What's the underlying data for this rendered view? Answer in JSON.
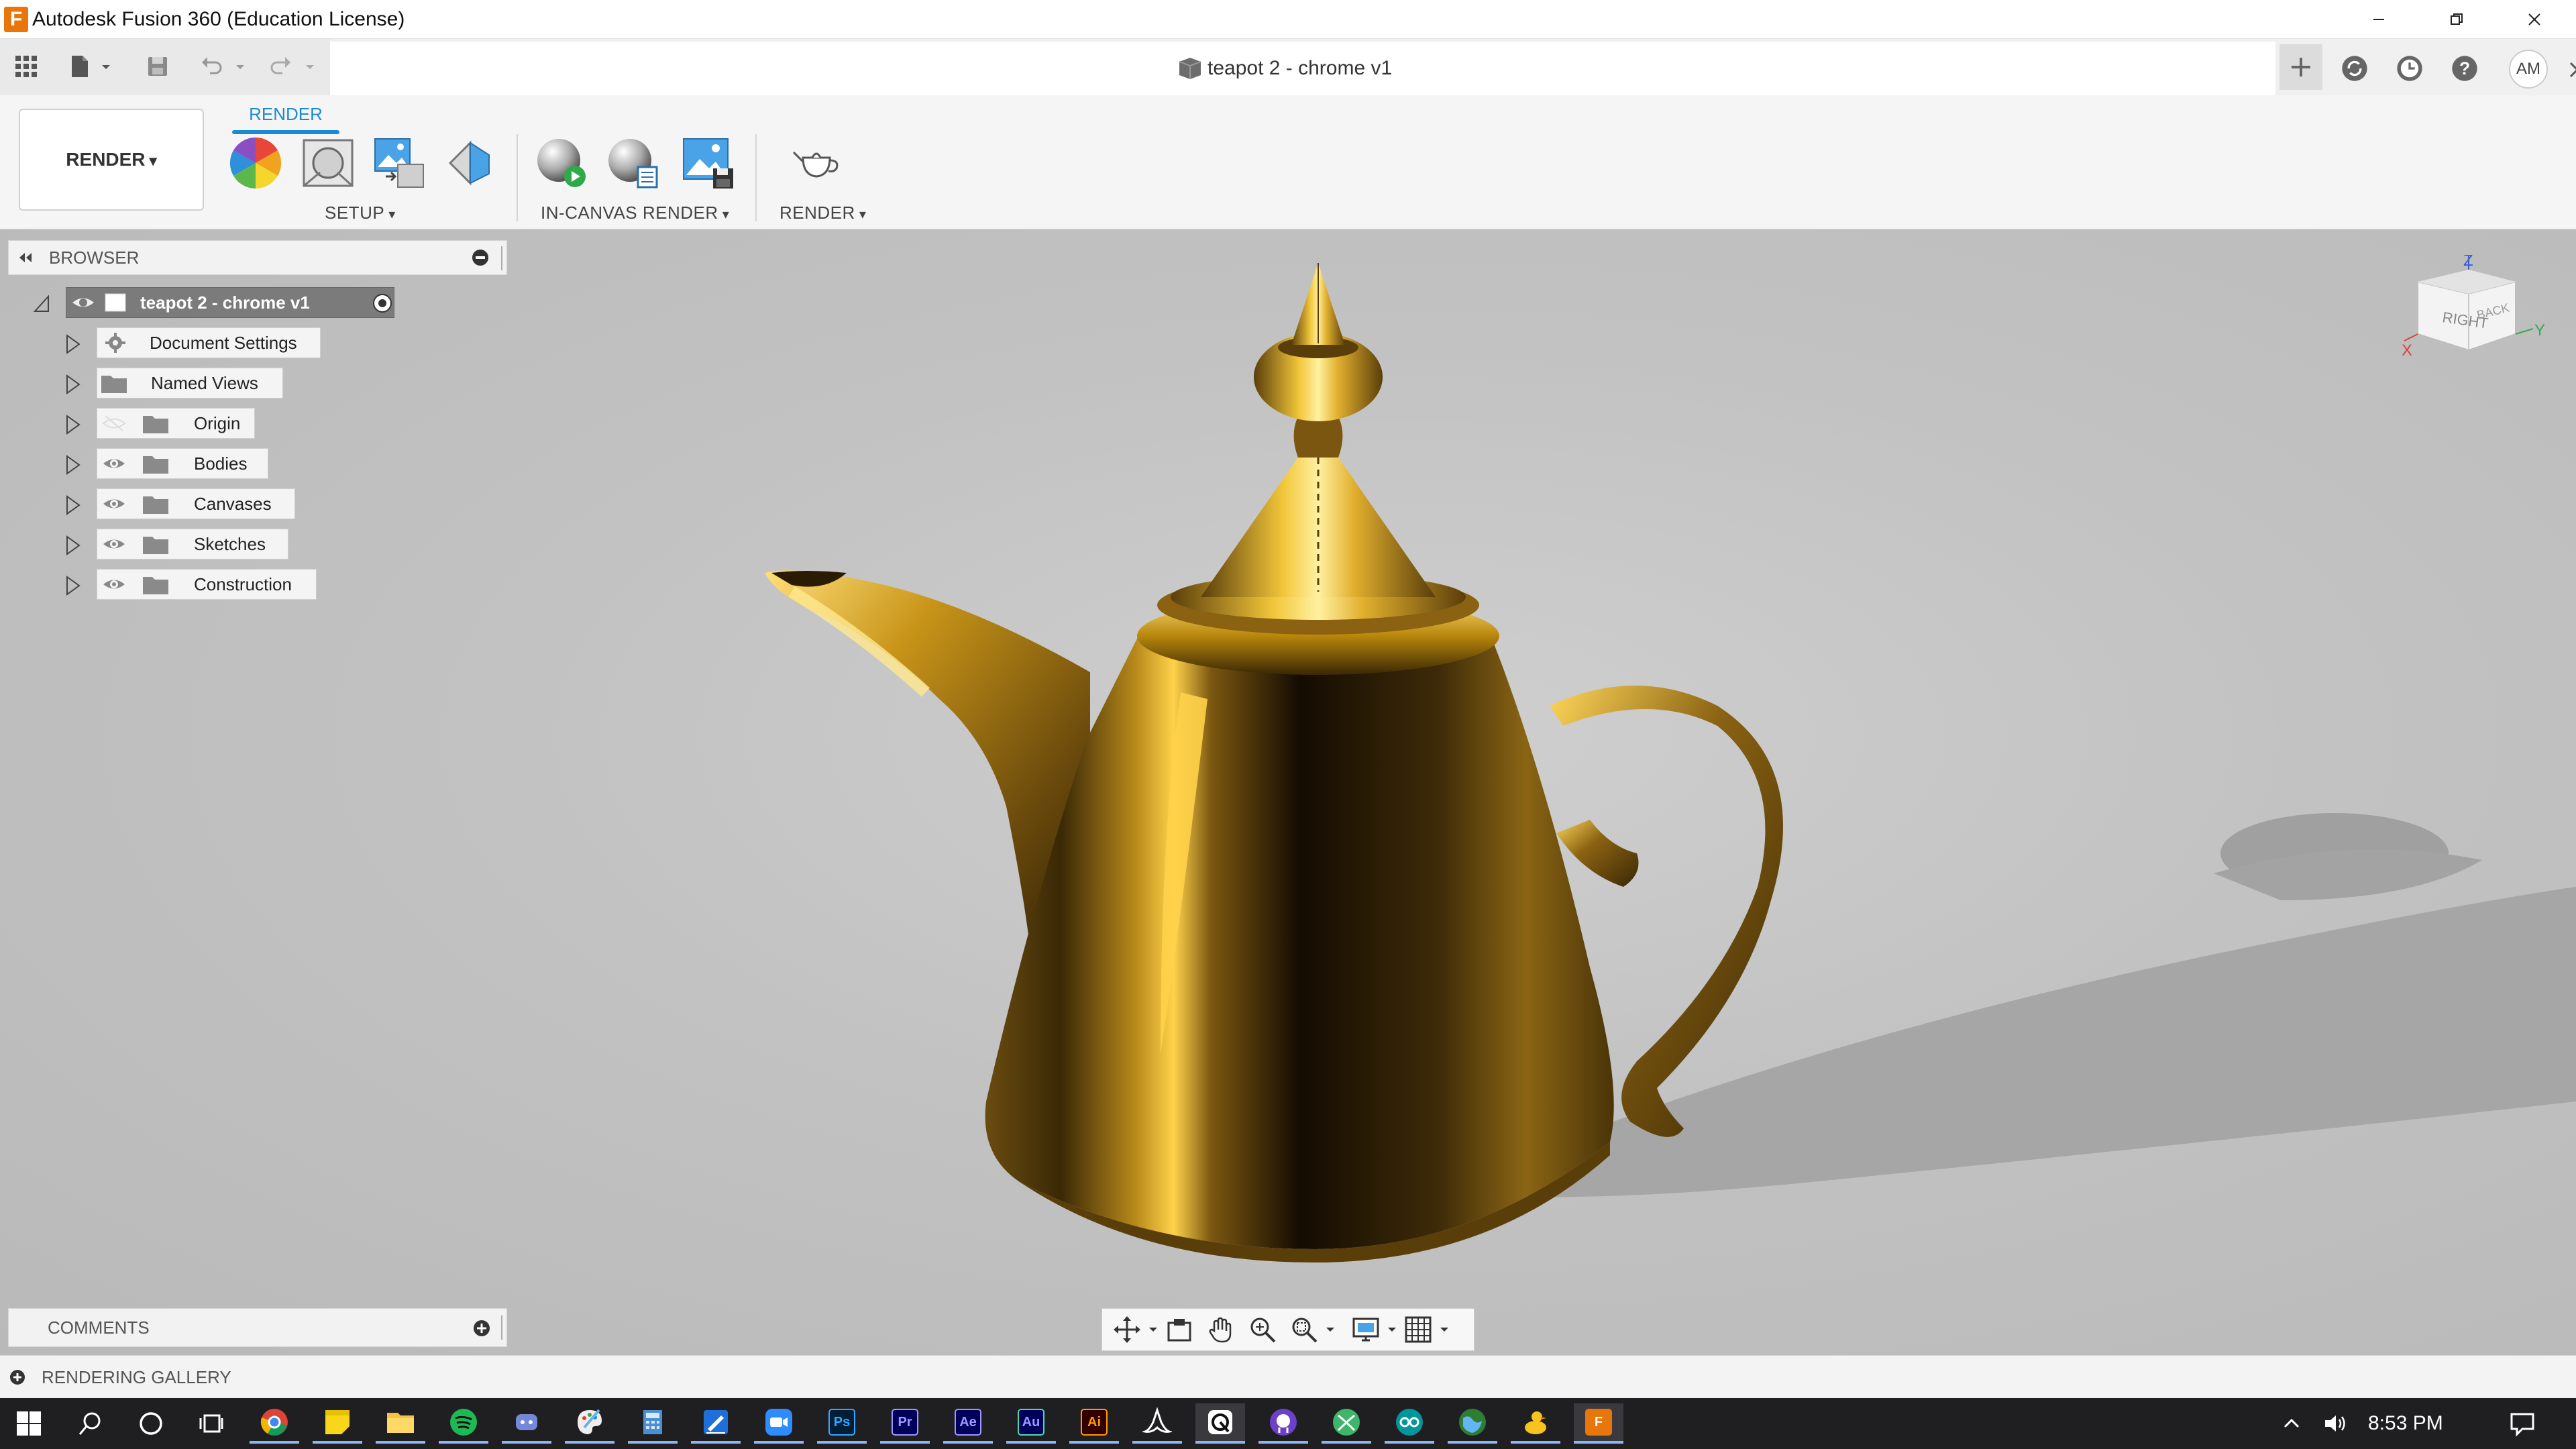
{
  "window": {
    "logo_letter": "F",
    "title": "Autodesk Fusion 360 (Education License)"
  },
  "document_tab": {
    "title": "teapot 2 - chrome v1"
  },
  "user": {
    "initials": "AM"
  },
  "ribbon": {
    "workspace": "RENDER",
    "active_tab": "RENDER",
    "groups": [
      {
        "label": "SETUP"
      },
      {
        "label": "IN-CANVAS RENDER"
      },
      {
        "label": "RENDER"
      }
    ]
  },
  "browser": {
    "title": "BROWSER",
    "root": "teapot 2 - chrome v1",
    "items": [
      {
        "label": "Document Settings"
      },
      {
        "label": "Named Views"
      },
      {
        "label": "Origin"
      },
      {
        "label": "Bodies"
      },
      {
        "label": "Canvases"
      },
      {
        "label": "Sketches"
      },
      {
        "label": "Construction"
      }
    ]
  },
  "comments": {
    "title": "COMMENTS"
  },
  "gallery": {
    "title": "RENDERING GALLERY"
  },
  "viewcube": {
    "right": "RIGHT",
    "back": "BACK",
    "z": "Z",
    "x": "X",
    "y": "Y"
  },
  "taskbar": {
    "apps": [
      {
        "name": "Chrome"
      },
      {
        "name": "Sticky Notes"
      },
      {
        "name": "File Explorer"
      },
      {
        "name": "Spotify"
      },
      {
        "name": "Discord"
      },
      {
        "name": "Paint"
      },
      {
        "name": "Calculator"
      },
      {
        "name": "Whiteboard"
      },
      {
        "name": "Zoom"
      },
      {
        "name": "Photoshop",
        "abbr": "Ps"
      },
      {
        "name": "Premiere Pro",
        "abbr": "Pr"
      },
      {
        "name": "After Effects",
        "abbr": "Ae"
      },
      {
        "name": "Audition",
        "abbr": "Au"
      },
      {
        "name": "Illustrator",
        "abbr": "Ai"
      },
      {
        "name": "Acrobat"
      },
      {
        "name": "Snipping Tool"
      },
      {
        "name": "GitHub"
      },
      {
        "name": "Xbox"
      },
      {
        "name": "Arduino"
      },
      {
        "name": "Browser"
      },
      {
        "name": "Cyberduck"
      },
      {
        "name": "Fusion 360",
        "abbr": "F"
      }
    ],
    "clock": "8:53 PM"
  },
  "colors": {
    "accent": "#1a8ad4",
    "fusion_orange": "#e8760a",
    "viewport_bg": "#c2c2c2",
    "gold": "#b8860b"
  }
}
